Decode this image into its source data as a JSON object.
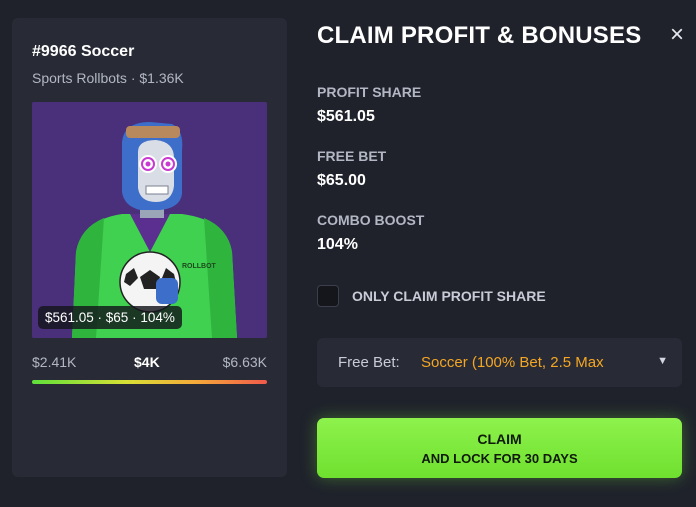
{
  "nft": {
    "title": "#9966 Soccer",
    "subtitle": "Sports Rollbots · $1.36K",
    "stats_badge": "$561.05 · $65 · 104%",
    "jersey_text": "ROLLBOT",
    "price_low": "$2.41K",
    "price_mid": "$4K",
    "price_high": "$6.63K"
  },
  "modal": {
    "title": "CLAIM PROFIT & BONUSES",
    "close_label": "×"
  },
  "stats": [
    {
      "label": "PROFIT SHARE",
      "value": "$561.05"
    },
    {
      "label": "FREE BET",
      "value": "$65.00"
    },
    {
      "label": "COMBO BOOST",
      "value": "104%"
    }
  ],
  "checkbox": {
    "label": "ONLY CLAIM PROFIT SHARE",
    "checked": false
  },
  "select": {
    "label": "Free Bet:",
    "value": "Soccer (100% Bet, 2.5 Max",
    "arrow": "▼"
  },
  "claim": {
    "main_label": "CLAIM",
    "sub_label": "AND LOCK FOR 30 DAYS"
  },
  "colors": {
    "background": "#1f222b",
    "card": "#282b35",
    "accent_green": "#7be83a",
    "accent_orange": "#f5a623",
    "nft_bg": "#4a2f7b"
  }
}
